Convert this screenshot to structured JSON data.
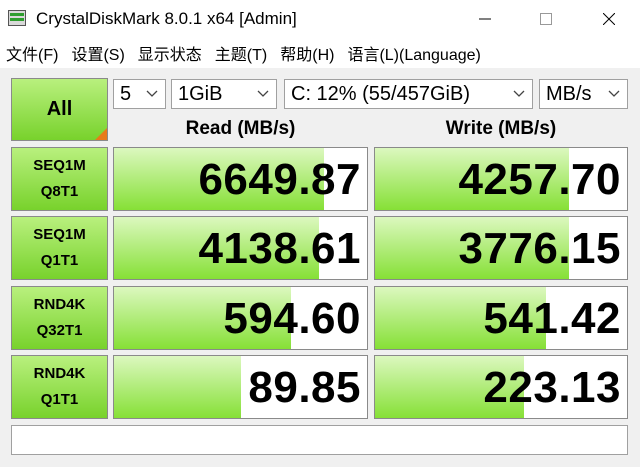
{
  "window": {
    "title": "CrystalDiskMark 8.0.1 x64 [Admin]"
  },
  "menu": {
    "items": [
      "文件(F)",
      "设置(S)",
      "显示状态",
      "主题(T)",
      "帮助(H)",
      "语言(L)(Language)"
    ]
  },
  "controls": {
    "all_label": "All",
    "test_count": "5",
    "test_size": "1GiB",
    "drive": "C: 12% (55/457GiB)",
    "unit": "MB/s"
  },
  "headers": {
    "read": "Read (MB/s)",
    "write": "Write (MB/s)"
  },
  "rows": [
    {
      "label1": "SEQ1M",
      "label2": "Q8T1",
      "read": "6649.87",
      "write": "4257.70",
      "read_fill": 0.83,
      "write_fill": 0.77
    },
    {
      "label1": "SEQ1M",
      "label2": "Q1T1",
      "read": "4138.61",
      "write": "3776.15",
      "read_fill": 0.81,
      "write_fill": 0.77
    },
    {
      "label1": "RND4K",
      "label2": "Q32T1",
      "read": "594.60",
      "write": "541.42",
      "read_fill": 0.7,
      "write_fill": 0.68
    },
    {
      "label1": "RND4K",
      "label2": "Q1T1",
      "read": "89.85",
      "write": "223.13",
      "read_fill": 0.5,
      "write_fill": 0.59
    }
  ],
  "comment": "",
  "colors": {
    "bar_light": "#dcf8bf",
    "bar_dark": "#86e036",
    "button_light": "#b9f07e",
    "button_dark": "#78d22c",
    "accent_corner": "#e87a1a"
  }
}
